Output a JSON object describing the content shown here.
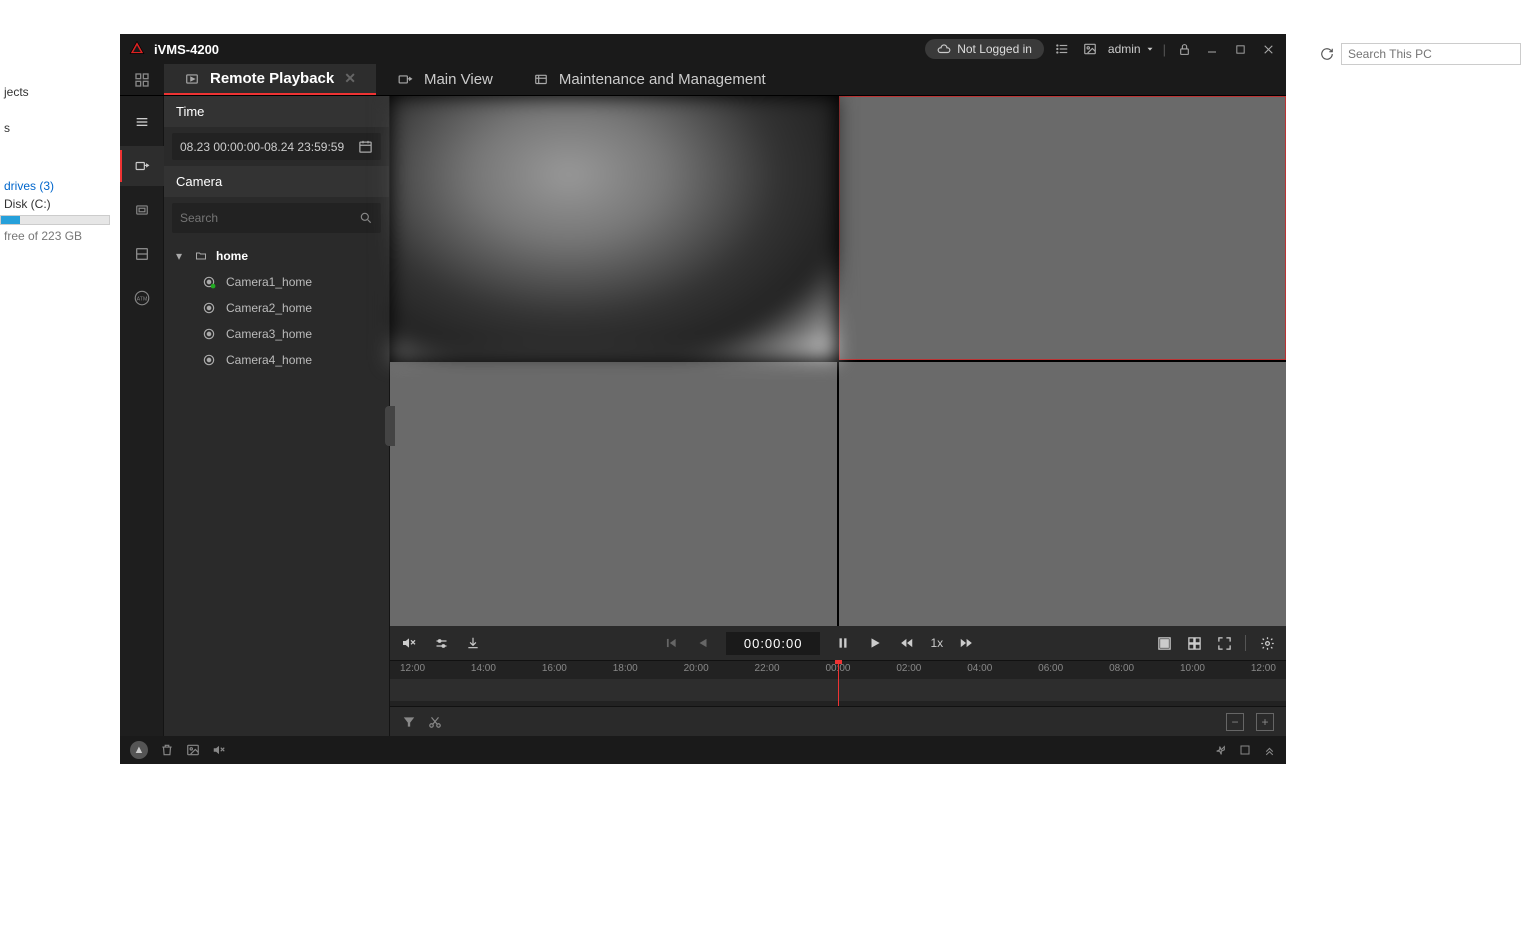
{
  "explorer": {
    "item1": "jects",
    "item2": "s",
    "drives_label": "drives (3)",
    "disk_label": "Disk (C:)",
    "disk_free": "free of 223 GB",
    "search_placeholder": "Search This PC"
  },
  "app": {
    "title": "iVMS-4200",
    "login_status": "Not Logged in",
    "user": "admin"
  },
  "tabs": [
    {
      "label": "Remote Playback",
      "active": true,
      "closable": true
    },
    {
      "label": "Main View",
      "active": false,
      "closable": false
    },
    {
      "label": "Maintenance and Management",
      "active": false,
      "closable": false
    }
  ],
  "sidebar": {
    "time_title": "Time",
    "time_range": "08.23 00:00:00-08.24 23:59:59",
    "camera_title": "Camera",
    "search_placeholder": "Search",
    "tree": {
      "root": "home",
      "cameras": [
        "Camera1_home",
        "Camera2_home",
        "Camera3_home",
        "Camera4_home"
      ]
    }
  },
  "playback": {
    "timecode": "00:00:00",
    "speed": "1x"
  },
  "timeline": {
    "ticks": [
      "12:00",
      "14:00",
      "16:00",
      "18:00",
      "20:00",
      "22:00",
      "00:00",
      "02:00",
      "04:00",
      "06:00",
      "08:00",
      "10:00",
      "12:00"
    ]
  }
}
